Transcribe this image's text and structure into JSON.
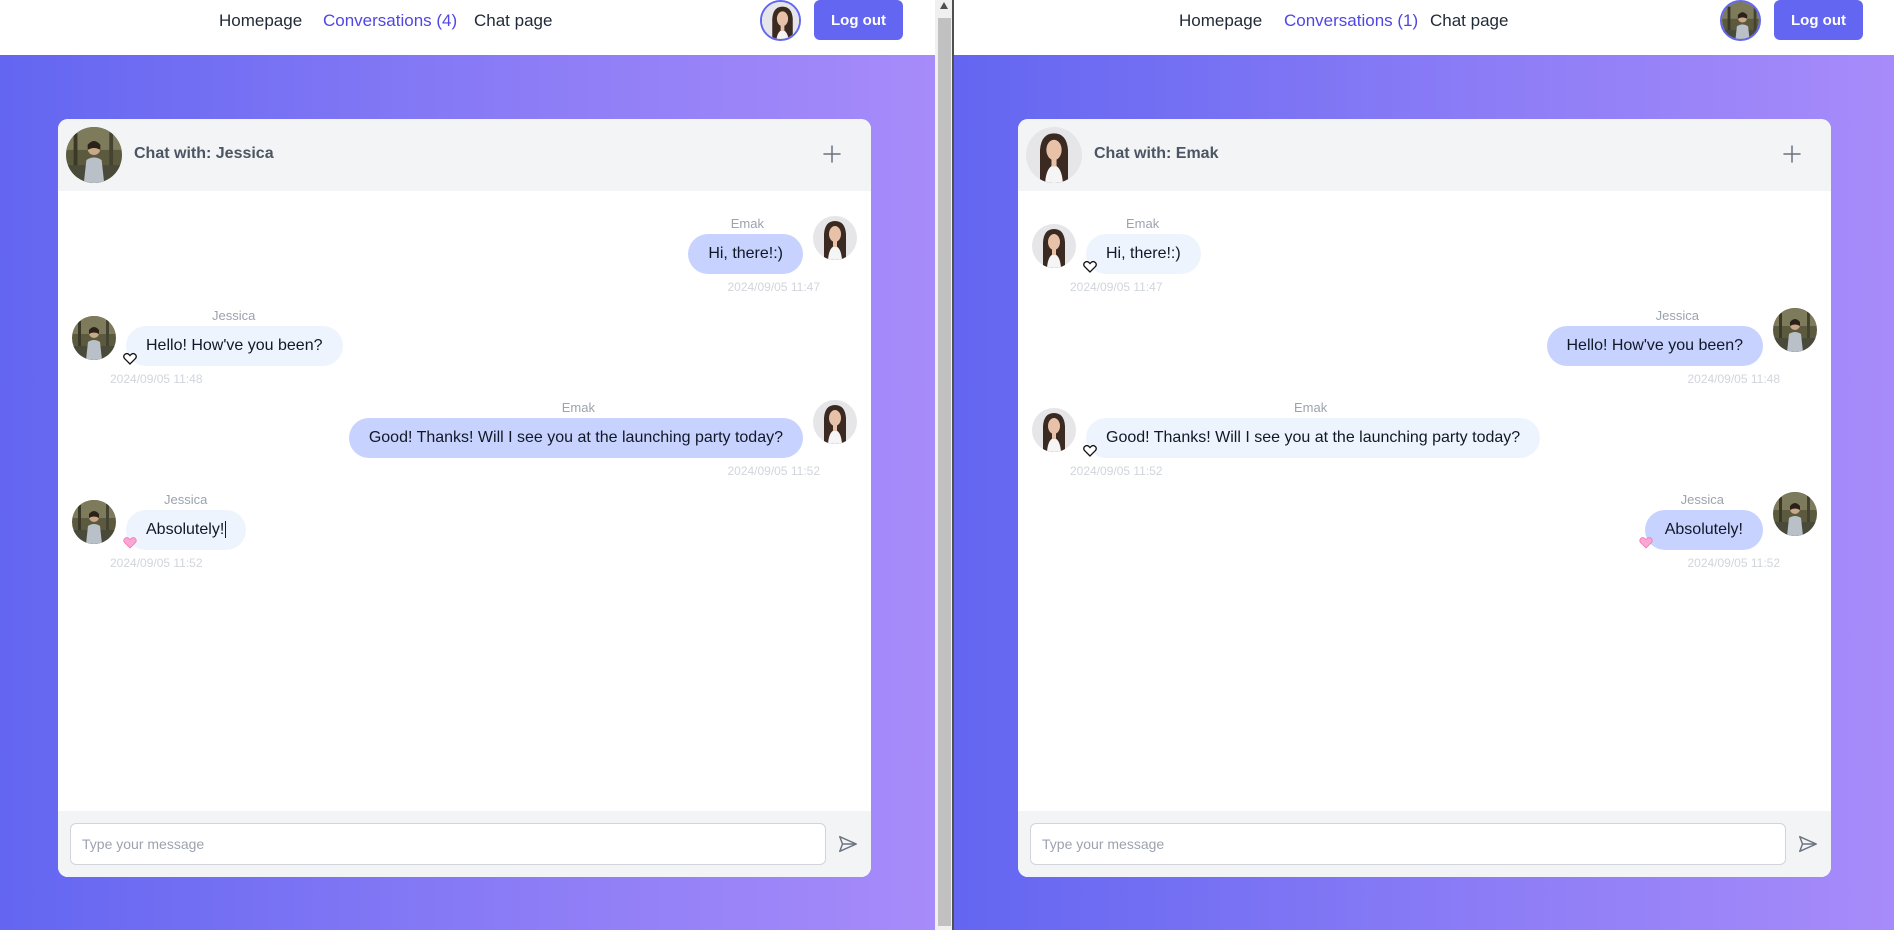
{
  "left": {
    "nav": {
      "homepage": "Homepage",
      "conversations": "Conversations (4)",
      "chat_page": "Chat page",
      "logout": "Log out"
    },
    "chat": {
      "title": "Chat with: Jessica",
      "input_placeholder": "Type your message",
      "messages": [
        {
          "sender": "Emak",
          "text": "Hi, there!:)",
          "time": "2024/09/05 11:47",
          "side": "right"
        },
        {
          "sender": "Jessica",
          "text": "Hello! How've you been?",
          "time": "2024/09/05 11:48",
          "side": "left",
          "liked": false
        },
        {
          "sender": "Emak",
          "text": "Good! Thanks! Will I see you at the launching party today?",
          "time": "2024/09/05 11:52",
          "side": "right"
        },
        {
          "sender": "Jessica",
          "text": "Absolutely!",
          "time": "2024/09/05 11:52",
          "side": "left",
          "liked": true
        }
      ]
    }
  },
  "right": {
    "nav": {
      "homepage": "Homepage",
      "conversations": "Conversations (1)",
      "chat_page": "Chat page",
      "logout": "Log out"
    },
    "chat": {
      "title": "Chat with: Emak",
      "input_placeholder": "Type your message",
      "messages": [
        {
          "sender": "Emak",
          "text": "Hi, there!:)",
          "time": "2024/09/05 11:47",
          "side": "left",
          "liked": false
        },
        {
          "sender": "Jessica",
          "text": "Hello! How've you been?",
          "time": "2024/09/05 11:48",
          "side": "right"
        },
        {
          "sender": "Emak",
          "text": "Good! Thanks! Will I see you at the launching party today?",
          "time": "2024/09/05 11:52",
          "side": "left",
          "liked": false
        },
        {
          "sender": "Jessica",
          "text": "Absolutely!",
          "time": "2024/09/05 11:52",
          "side": "right",
          "liked": true
        }
      ]
    }
  },
  "colors": {
    "accent": "#6366f1",
    "gradient_start": "#6366f1",
    "gradient_end": "#a78bfa",
    "my_bubble": "#c7d2fe",
    "other_bubble": "#eef4fd",
    "heart_liked": "#f9a8d4"
  },
  "icons": {
    "add": "plus-icon",
    "send": "send-icon",
    "like": "heart-icon",
    "avatar_jessica": "woman-portrait-photo",
    "avatar_emak": "street-portrait-photo"
  }
}
